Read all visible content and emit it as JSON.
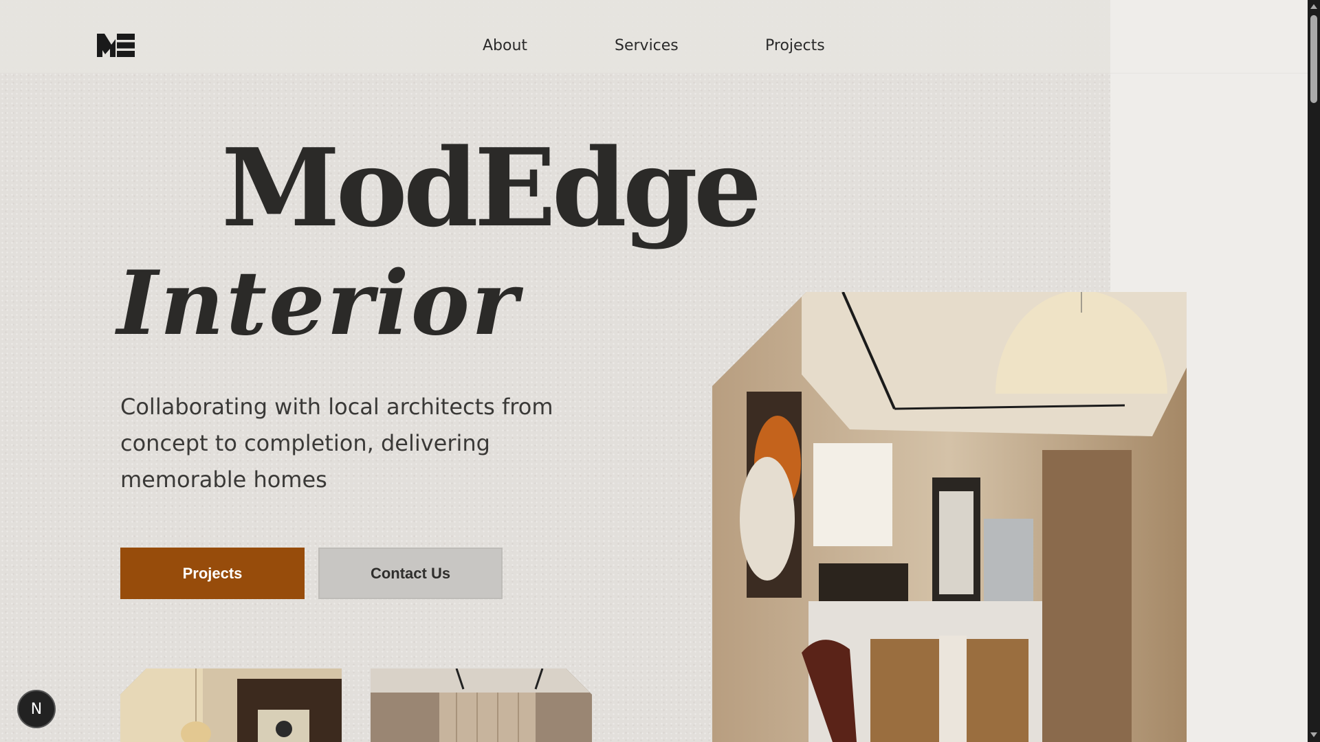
{
  "nav": {
    "logo_label": "ME",
    "links": [
      {
        "label": "About"
      },
      {
        "label": "Services"
      },
      {
        "label": "Projects"
      }
    ]
  },
  "hero": {
    "title": "ModEdge",
    "subtitle": "Interior",
    "tagline": "Collaborating with local architects from concept to completion, delivering memorable homes",
    "primary_button": "Projects",
    "secondary_button": "Contact Us"
  },
  "dev_badge": "N",
  "colors": {
    "accent": "#974c0b",
    "secondary_button": "#c8c6c3",
    "text": "#2b2a28",
    "background": "#e2dfdb"
  },
  "icons": {
    "logo": "me-monogram-icon",
    "badge": "nextjs-icon"
  }
}
